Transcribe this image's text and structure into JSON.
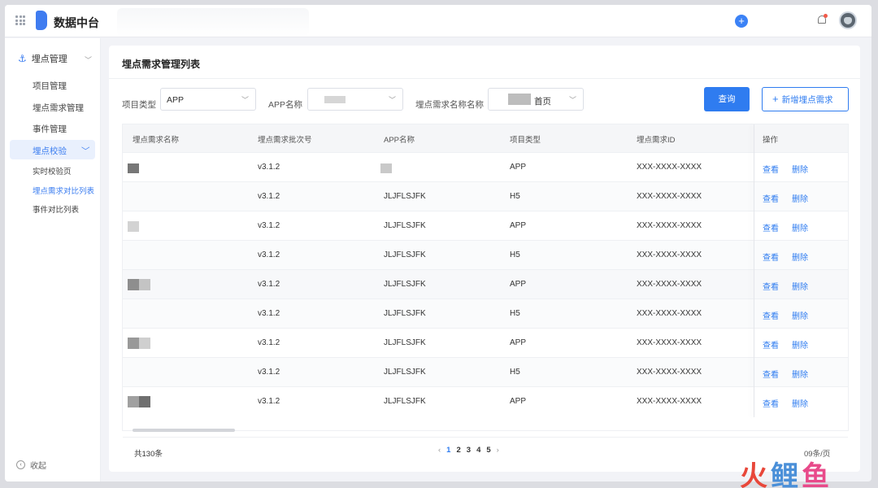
{
  "header": {
    "app_title": "数据中台",
    "icons": [
      "grid-icon",
      "logo",
      "plus-icon",
      "bell-icon",
      "avatar"
    ]
  },
  "sidebar": {
    "group_label": "埋点管理",
    "items": [
      "项目管理",
      "埋点需求管理",
      "事件管理"
    ],
    "active_group": "埋点校验",
    "sub_items": [
      "实时校验页",
      "埋点需求对比列表",
      "事件对比列表"
    ],
    "active_sub_index": 1,
    "collapse_label": "收起"
  },
  "panel": {
    "title": "埋点需求管理列表"
  },
  "filters": {
    "project_type_label": "项目类型",
    "project_type_value": "APP",
    "app_name_label": "APP名称",
    "req_name_label": "埋点需求名称名称",
    "req_name_value": "首页",
    "query_button": "查询",
    "add_button": "新增埋点需求"
  },
  "table": {
    "columns": [
      "埋点需求名称",
      "埋点需求批次号",
      "APP名称",
      "项目类型",
      "埋点需求ID",
      "操作"
    ],
    "rows": [
      {
        "batch": "v3.1.2",
        "app": "",
        "type": "APP",
        "id": "XXX-XXXX-XXXX"
      },
      {
        "batch": "v3.1.2",
        "app": "JLJFLSJFK",
        "type": "H5",
        "id": "XXX-XXXX-XXXX"
      },
      {
        "batch": "v3.1.2",
        "app": "JLJFLSJFK",
        "type": "APP",
        "id": "XXX-XXXX-XXXX"
      },
      {
        "batch": "v3.1.2",
        "app": "JLJFLSJFK",
        "type": "H5",
        "id": "XXX-XXXX-XXXX"
      },
      {
        "batch": "v3.1.2",
        "app": "JLJFLSJFK",
        "type": "APP",
        "id": "XXX-XXXX-XXXX"
      },
      {
        "batch": "v3.1.2",
        "app": "JLJFLSJFK",
        "type": "H5",
        "id": "XXX-XXXX-XXXX"
      },
      {
        "batch": "v3.1.2",
        "app": "JLJFLSJFK",
        "type": "APP",
        "id": "XXX-XXXX-XXXX"
      },
      {
        "batch": "v3.1.2",
        "app": "JLJFLSJFK",
        "type": "H5",
        "id": "XXX-XXXX-XXXX"
      },
      {
        "batch": "v3.1.2",
        "app": "JLJFLSJFK",
        "type": "APP",
        "id": "XXX-XXXX-XXXX"
      }
    ],
    "view_label": "查看",
    "delete_label": "删除"
  },
  "pagination": {
    "total": "共130条",
    "pages": [
      "1",
      "2",
      "3",
      "4",
      "5"
    ],
    "current_page": "1",
    "page_size": "09条/页"
  },
  "watermark": {
    "chars": [
      "火",
      "鲤",
      "鱼"
    ]
  },
  "colors": {
    "accent": "#2f7cf0",
    "active_bg": "#e9f0fd"
  }
}
